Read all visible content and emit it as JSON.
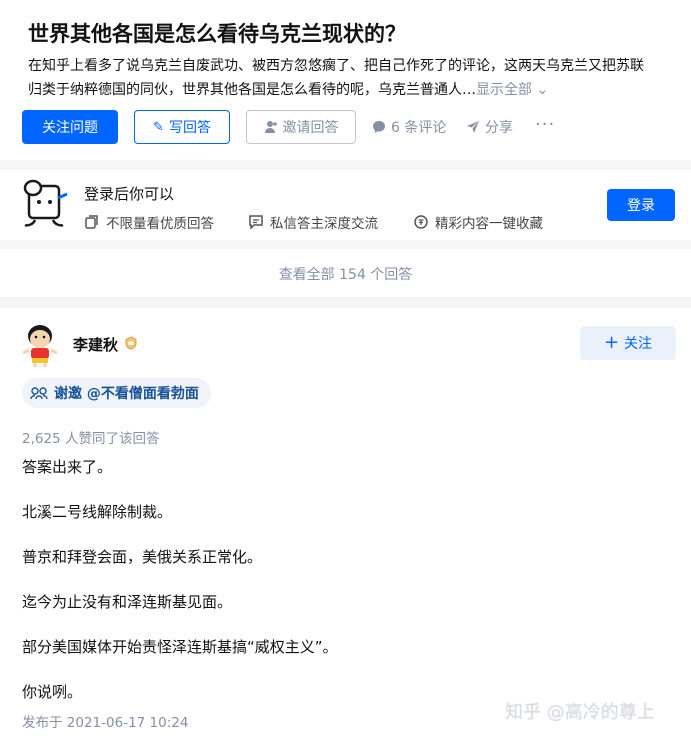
{
  "question": {
    "title": "世界其他各国是怎么看待乌克兰现状的？",
    "desc_line1": "在知乎上看多了说乌克兰自废武功、被西方忽悠瘸了、把自己作死了的评论，这两天乌克兰又把苏联",
    "desc_line2": "归类于纳粹德国的同伙，世界其他各国是怎么看待的呢，乌克兰普通人…",
    "show_all": "显示全部 ⌄",
    "follow_label": "关注问题",
    "write_label": "写回答",
    "invite_label": "邀请回答",
    "comments_label": "6 条评论",
    "share_label": "分享",
    "more_label": "···"
  },
  "login_banner": {
    "title": "登录后你可以",
    "perk1": "不限量看优质回答",
    "perk2": "私信答主深度交流",
    "perk3": "精彩内容一键收藏",
    "button": "登录"
  },
  "view_all": "查看全部 154 个回答",
  "answer": {
    "author": "李建秋",
    "follow_label": "关注",
    "invited_by": "谢邀 @不看僧面看勃面",
    "upvotes": "2,625 人赞同了该回答",
    "paragraphs": [
      "答案出来了。",
      "北溪二号线解除制裁。",
      "普京和拜登会面，美俄关系正常化。",
      "迄今为止没有和泽连斯基见面。",
      "部分美国媒体开始责怪泽连斯基搞“威权主义”。",
      "你说咧。"
    ],
    "published": "发布于 2021-06-17 10:24"
  },
  "watermark": "知乎 @高冷的尊上",
  "icons": {
    "write": "pencil-icon",
    "invite": "person-plus-icon",
    "comments": "comment-bubble-icon",
    "share": "paper-plane-icon",
    "perk1": "copy-icon",
    "perk2": "message-icon",
    "perk3": "bookmark-icon",
    "invite_tag": "people-icon"
  },
  "colors": {
    "brand": "#0066ff",
    "muted": "#8590a6",
    "invite_text": "#175199"
  }
}
